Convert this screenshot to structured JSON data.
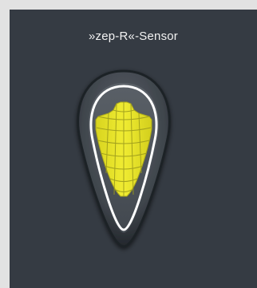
{
  "sensor": {
    "title": "»zep-R«-Sensor",
    "icon": "zep-r-sensor-droplet-icon"
  },
  "colors": {
    "page_background": "#e2e2e2",
    "panel_background": "#353b43",
    "title_text": "#f2f2f2",
    "sensor_body": "#4a5057",
    "sensor_outline": "#ffffff",
    "sensor_fill": "#e4e12a",
    "sensor_grid": "#9b9a1c"
  }
}
